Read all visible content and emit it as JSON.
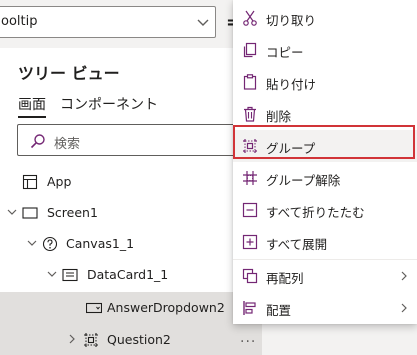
{
  "property_bar": {
    "selected_property": "ooltip",
    "equals": "="
  },
  "tree_view": {
    "title": "ツリー ビュー",
    "tabs": [
      {
        "label": "画面",
        "active": true
      },
      {
        "label": "コンポーネント",
        "active": false
      }
    ],
    "search_placeholder": "検索",
    "items": [
      {
        "label": "App",
        "icon": "app-icon",
        "expand": "none"
      },
      {
        "label": "Screen1",
        "icon": "screen-icon",
        "expand": "expanded"
      },
      {
        "label": "Canvas1_1",
        "icon": "canvas-icon",
        "expand": "expanded"
      },
      {
        "label": "DataCard1_1",
        "icon": "datacard-icon",
        "expand": "expanded"
      },
      {
        "label": "AnswerDropdown2",
        "icon": "dropdown-icon",
        "expand": "none",
        "selected": true
      },
      {
        "label": "Question2",
        "icon": "group-icon",
        "expand": "collapsed",
        "selected": true
      }
    ],
    "more": "..."
  },
  "context_menu": {
    "items": [
      {
        "label": "切り取り",
        "icon": "cut-icon"
      },
      {
        "label": "コピー",
        "icon": "copy-icon"
      },
      {
        "label": "貼り付け",
        "icon": "paste-icon"
      },
      {
        "label": "削除",
        "icon": "delete-icon"
      },
      {
        "label": "グループ",
        "icon": "group-icon",
        "highlighted": true
      },
      {
        "label": "グループ解除",
        "icon": "ungroup-icon"
      },
      {
        "label": "すべて折りたたむ",
        "icon": "collapse-all-icon"
      },
      {
        "label": "すべて展開",
        "icon": "expand-all-icon"
      },
      {
        "label": "再配列",
        "icon": "reorder-icon",
        "submenu": true
      },
      {
        "label": "配置",
        "icon": "align-icon",
        "submenu": true
      }
    ]
  },
  "colors": {
    "accent_purple": "#742774",
    "highlight_border": "#d13438",
    "selected_row": "#e1dfdd"
  }
}
